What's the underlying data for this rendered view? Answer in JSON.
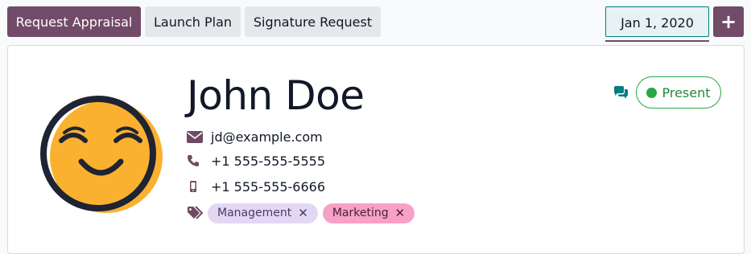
{
  "toolbar": {
    "request_appraisal": "Request Appraisal",
    "launch_plan": "Launch Plan",
    "signature_request": "Signature Request",
    "date": "Jan 1, 2020",
    "add": "+"
  },
  "employee": {
    "name": "John Doe",
    "email": "jd@example.com",
    "phone": "+1 555-555-5555",
    "mobile": "+1 555-555-6666",
    "tags": [
      {
        "label": "Management",
        "remove": "✕"
      },
      {
        "label": "Marketing",
        "remove": "✕"
      }
    ],
    "status": "Present"
  },
  "icons": {
    "email": "envelope-icon",
    "phone": "phone-icon",
    "mobile": "mobile-phone-icon",
    "tags": "tags-icon",
    "chat": "chat-bubbles-icon",
    "avatar": "smiley-face-icon"
  },
  "colors": {
    "primary": "#714b67",
    "secondary": "#e5e7eb",
    "teal": "#017e84",
    "present_green": "#28a745",
    "tag_management": "#e3d8f4",
    "tag_marketing": "#f7a1c7",
    "avatar_yellow": "#fbb130",
    "avatar_outline": "#1f2433"
  }
}
